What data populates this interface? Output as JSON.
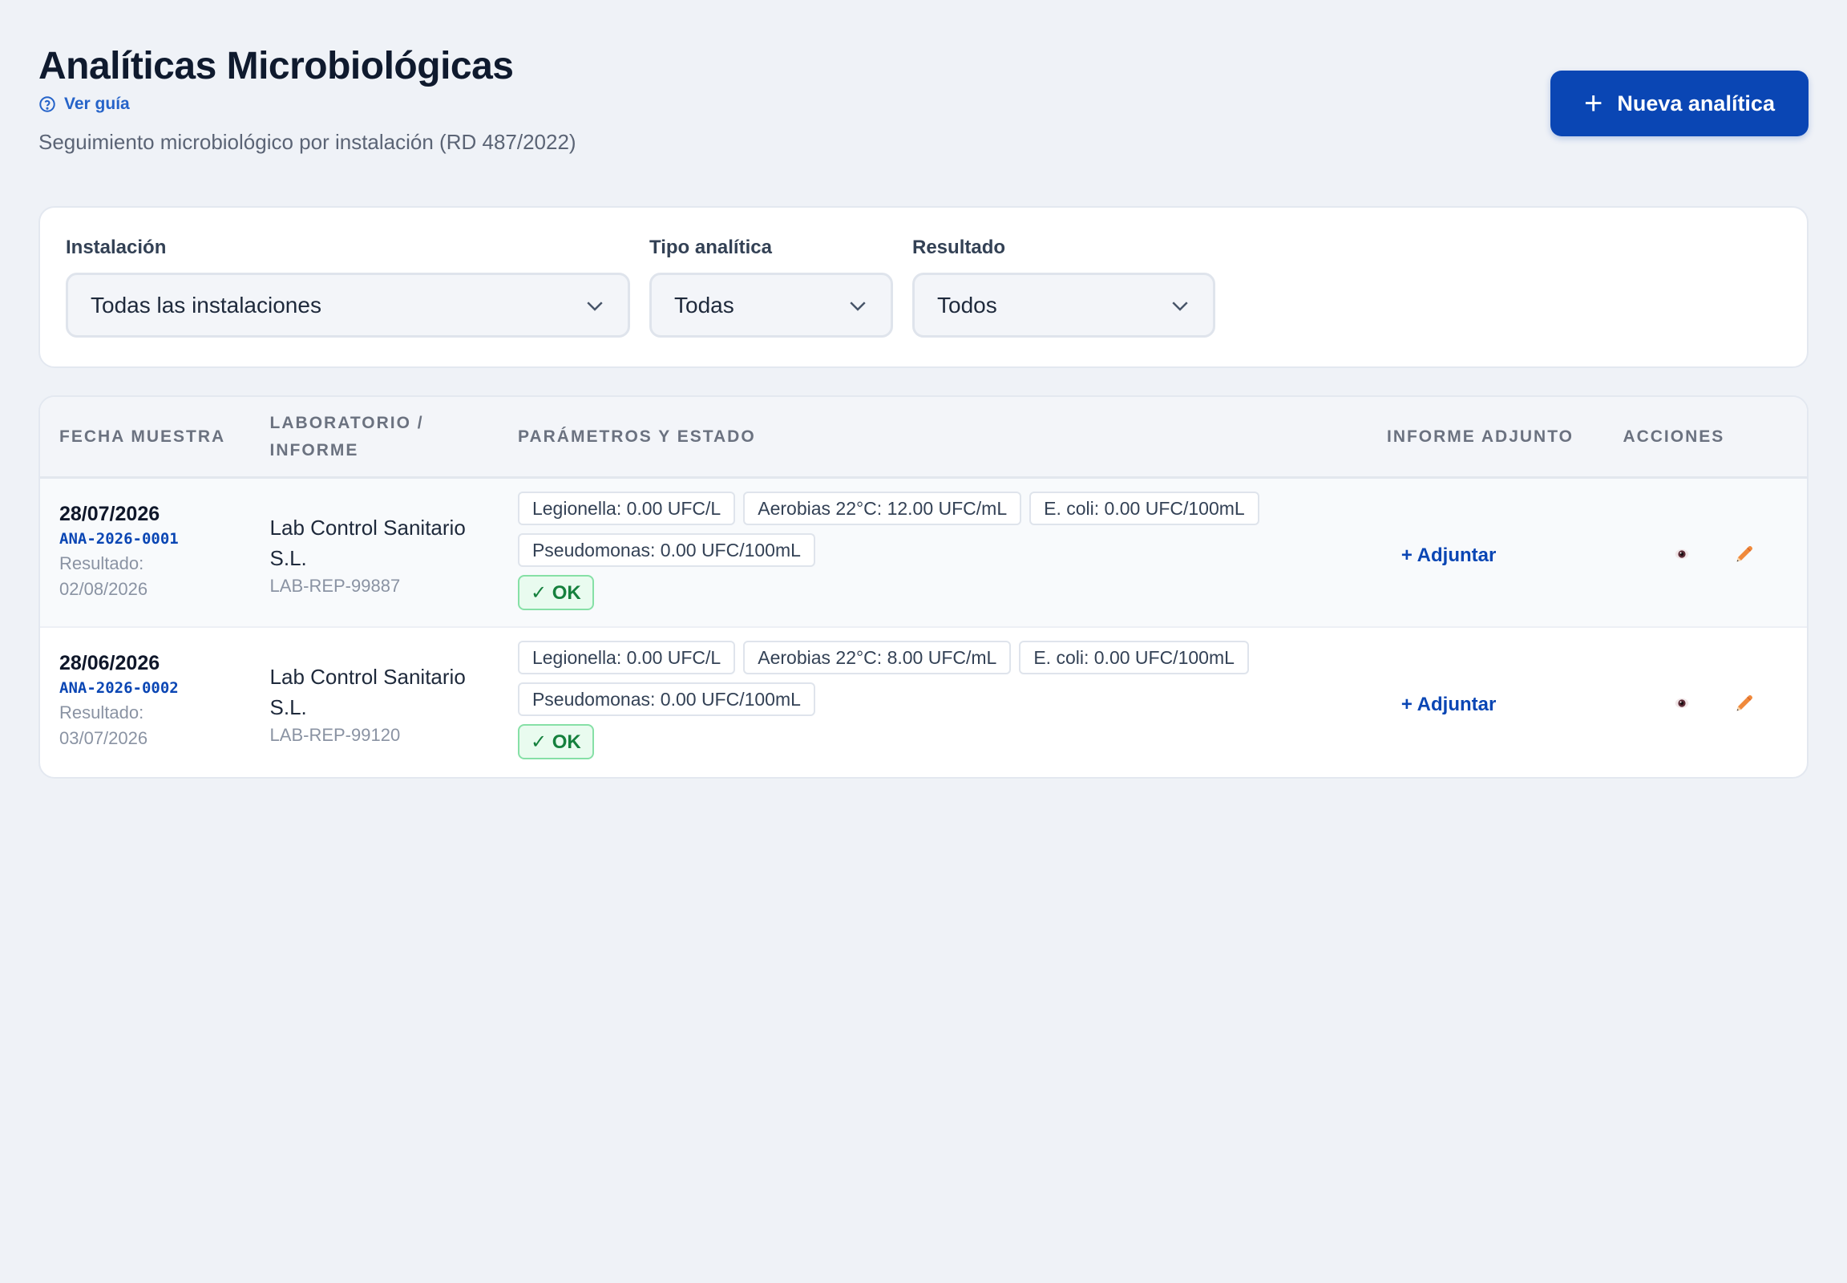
{
  "header": {
    "title": "Analíticas Microbiológicas",
    "guide_label": "Ver guía",
    "subtitle": "Seguimiento microbiológico por instalación (RD 487/2022)",
    "new_button": "Nueva analítica"
  },
  "filters": [
    {
      "label": "Instalación",
      "value": "Todas las instalaciones"
    },
    {
      "label": "Tipo analítica",
      "value": "Todas"
    },
    {
      "label": "Resultado",
      "value": "Todos"
    }
  ],
  "table": {
    "columns": [
      "FECHA MUESTRA",
      "LABORATORIO / INFORME",
      "PARÁMETROS Y ESTADO",
      "INFORME ADJUNTO",
      "ACCIONES"
    ],
    "rows": [
      {
        "date": "28/07/2026",
        "code": "ANA-2026-0001",
        "result_label": "Resultado:",
        "result_date": "02/08/2026",
        "lab": "Lab Control Sanitario S.L.",
        "report": "LAB-REP-99887",
        "params": [
          "Legionella: 0.00 UFC/L",
          "Aerobias 22°C: 12.00 UFC/mL",
          "E. coli: 0.00 UFC/100mL",
          "Pseudomonas: 0.00 UFC/100mL"
        ],
        "status": "✓ OK",
        "attach": "+ Adjuntar"
      },
      {
        "date": "28/06/2026",
        "code": "ANA-2026-0002",
        "result_label": "Resultado:",
        "result_date": "03/07/2026",
        "lab": "Lab Control Sanitario S.L.",
        "report": "LAB-REP-99120",
        "params": [
          "Legionella: 0.00 UFC/L",
          "Aerobias 22°C: 8.00 UFC/mL",
          "E. coli: 0.00 UFC/100mL",
          "Pseudomonas: 0.00 UFC/100mL"
        ],
        "status": "✓ OK",
        "attach": "+ Adjuntar"
      }
    ]
  },
  "colors": {
    "primary": "#0a46b4",
    "ok_text": "#15803d",
    "ok_bg": "#e9fbef",
    "background": "#eff2f7"
  }
}
